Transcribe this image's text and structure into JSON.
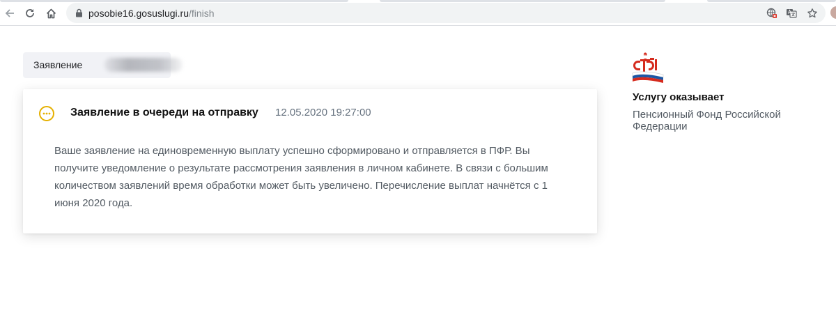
{
  "browser": {
    "url_host": "posobie16.gosuslugi.ru",
    "url_path": "/finish",
    "icons": [
      "back-arrow-icon",
      "reload-icon",
      "home-icon",
      "lock-icon",
      "site-permissions-icon",
      "translate-icon",
      "star-icon"
    ]
  },
  "application": {
    "label": "Заявление"
  },
  "status": {
    "title": "Заявление в очереди на отправку",
    "datetime": "12.05.2020 19:27:00",
    "icon": "pending-ellipsis-icon",
    "accent_color": "#e5b000",
    "message": "Ваше заявление на единовременную выплату успешно сформировано и отправляется в ПФР. Вы получите уведомление о результате рассмотрения заявления в личном кабинете. В связи с большим количеством заявлений время обработки может быть увеличено. Перечисление выплат начнётся с 1 июня 2020 года."
  },
  "provider": {
    "heading": "Услугу оказывает",
    "name": "Пенсионный Фонд Российской Федерации",
    "logo": "pfr-logo-icon"
  }
}
